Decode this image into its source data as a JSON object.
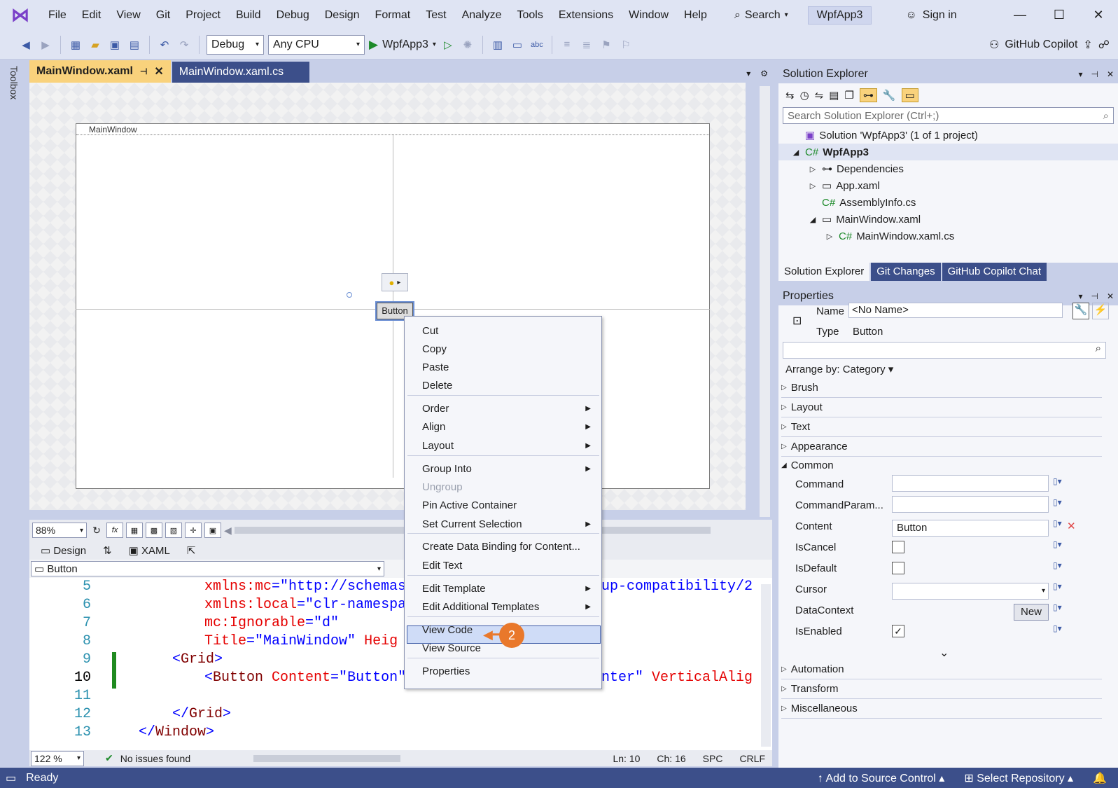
{
  "menubar": {
    "items": [
      "File",
      "Edit",
      "View",
      "Git",
      "Project",
      "Build",
      "Debug",
      "Design",
      "Format",
      "Test",
      "Analyze",
      "Tools",
      "Extensions",
      "Window",
      "Help"
    ],
    "search": "Search",
    "solution_badge": "WpfApp3",
    "sign_in": "Sign in"
  },
  "toolbar": {
    "config": "Debug",
    "platform": "Any CPU",
    "run_target": "WpfApp3",
    "copilot": "GitHub Copilot"
  },
  "toolbox": {
    "label": "Toolbox"
  },
  "tabs": [
    {
      "label": "MainWindow.xaml"
    },
    {
      "label": "MainWindow.xaml.cs"
    }
  ],
  "designer": {
    "window_title": "MainWindow",
    "button_text": "Button",
    "zoom": "88%"
  },
  "split": {
    "design": "Design",
    "swap": "⇅",
    "xaml": "XAML"
  },
  "navbar": {
    "element": "Button"
  },
  "code": [
    {
      "n": "5",
      "parts": [
        [
          "attr",
          "xmlns:mc"
        ],
        [
          "pun",
          "=\""
        ],
        [
          "val",
          "http://schemas"
        ]
      ],
      "tail": [
        [
          "val",
          "kup-compatibility/2"
        ]
      ]
    },
    {
      "n": "6",
      "parts": [
        [
          "attr",
          "xmlns:local"
        ],
        [
          "pun",
          "=\""
        ],
        [
          "val",
          "clr-namespa"
        ]
      ],
      "tail": []
    },
    {
      "n": "7",
      "parts": [
        [
          "attr",
          "mc:Ignorable"
        ],
        [
          "pun",
          "=\""
        ],
        [
          "val",
          "d\""
        ]
      ],
      "tail": []
    },
    {
      "n": "8",
      "parts": [
        [
          "attr",
          "Title"
        ],
        [
          "pun",
          "=\""
        ],
        [
          "val",
          "MainWindow\""
        ],
        [
          "attr",
          " Heig"
        ]
      ],
      "tail": []
    },
    {
      "n": "9",
      "parts": [
        [
          "pun",
          "<"
        ],
        [
          "tag",
          "Grid"
        ],
        [
          "pun",
          ">"
        ]
      ],
      "tail": []
    },
    {
      "n": "10",
      "parts": [
        [
          "pun",
          "<"
        ],
        [
          "tag",
          "Button"
        ],
        [
          "attr",
          " Content"
        ],
        [
          "pun",
          "=\""
        ],
        [
          "val",
          "Button\""
        ]
      ],
      "tail": [
        [
          "val",
          "enter\""
        ],
        [
          "attr",
          " VerticalAlig"
        ]
      ]
    },
    {
      "n": "11",
      "parts": [],
      "tail": []
    },
    {
      "n": "12",
      "parts": [
        [
          "pun",
          "</"
        ],
        [
          "tag",
          "Grid"
        ],
        [
          "pun",
          ">"
        ]
      ],
      "tail": []
    },
    {
      "n": "13",
      "parts": [
        [
          "pun",
          "</"
        ],
        [
          "tag",
          "Window"
        ],
        [
          "pun",
          ">"
        ]
      ],
      "tail": []
    }
  ],
  "editor_status": {
    "zoom": "122 %",
    "issues": "No issues found",
    "ln": "Ln: 10",
    "ch": "Ch: 16",
    "spc": "SPC",
    "crlf": "CRLF"
  },
  "status": {
    "ready": "Ready",
    "source_control": "Add to Source Control",
    "repo": "Select Repository"
  },
  "solution_explorer": {
    "title": "Solution Explorer",
    "search_placeholder": "Search Solution Explorer (Ctrl+;)",
    "solution": "Solution 'WpfApp3' (1 of 1 project)",
    "project": "WpfApp3",
    "items": [
      "Dependencies",
      "App.xaml",
      "AssemblyInfo.cs",
      "MainWindow.xaml",
      "MainWindow.xaml.cs"
    ],
    "tabs": [
      "Solution Explorer",
      "Git Changes",
      "GitHub Copilot Chat"
    ]
  },
  "properties": {
    "title": "Properties",
    "name_label": "Name",
    "name_value": "<No Name>",
    "type_label": "Type",
    "type_value": "Button",
    "arrange": "Arrange by: Category",
    "cats_top": [
      "Brush",
      "Layout",
      "Text",
      "Appearance"
    ],
    "common": "Common",
    "rows": [
      "Command",
      "CommandParam...",
      "Content",
      "IsCancel",
      "IsDefault",
      "Cursor",
      "DataContext",
      "IsEnabled"
    ],
    "content_value": "Button",
    "new_btn": "New",
    "cats_bottom": [
      "Automation",
      "Transform",
      "Miscellaneous"
    ]
  },
  "context_menu": {
    "items": [
      "Cut",
      "Copy",
      "Paste",
      "Delete",
      "Order",
      "Align",
      "Layout",
      "Group Into",
      "Ungroup",
      "Pin Active Container",
      "Set Current Selection",
      "Create Data Binding for Content...",
      "Edit Text",
      "Edit Template",
      "Edit Additional Templates",
      "View Code",
      "View Source",
      "Properties"
    ]
  },
  "callout": {
    "number": "2"
  }
}
